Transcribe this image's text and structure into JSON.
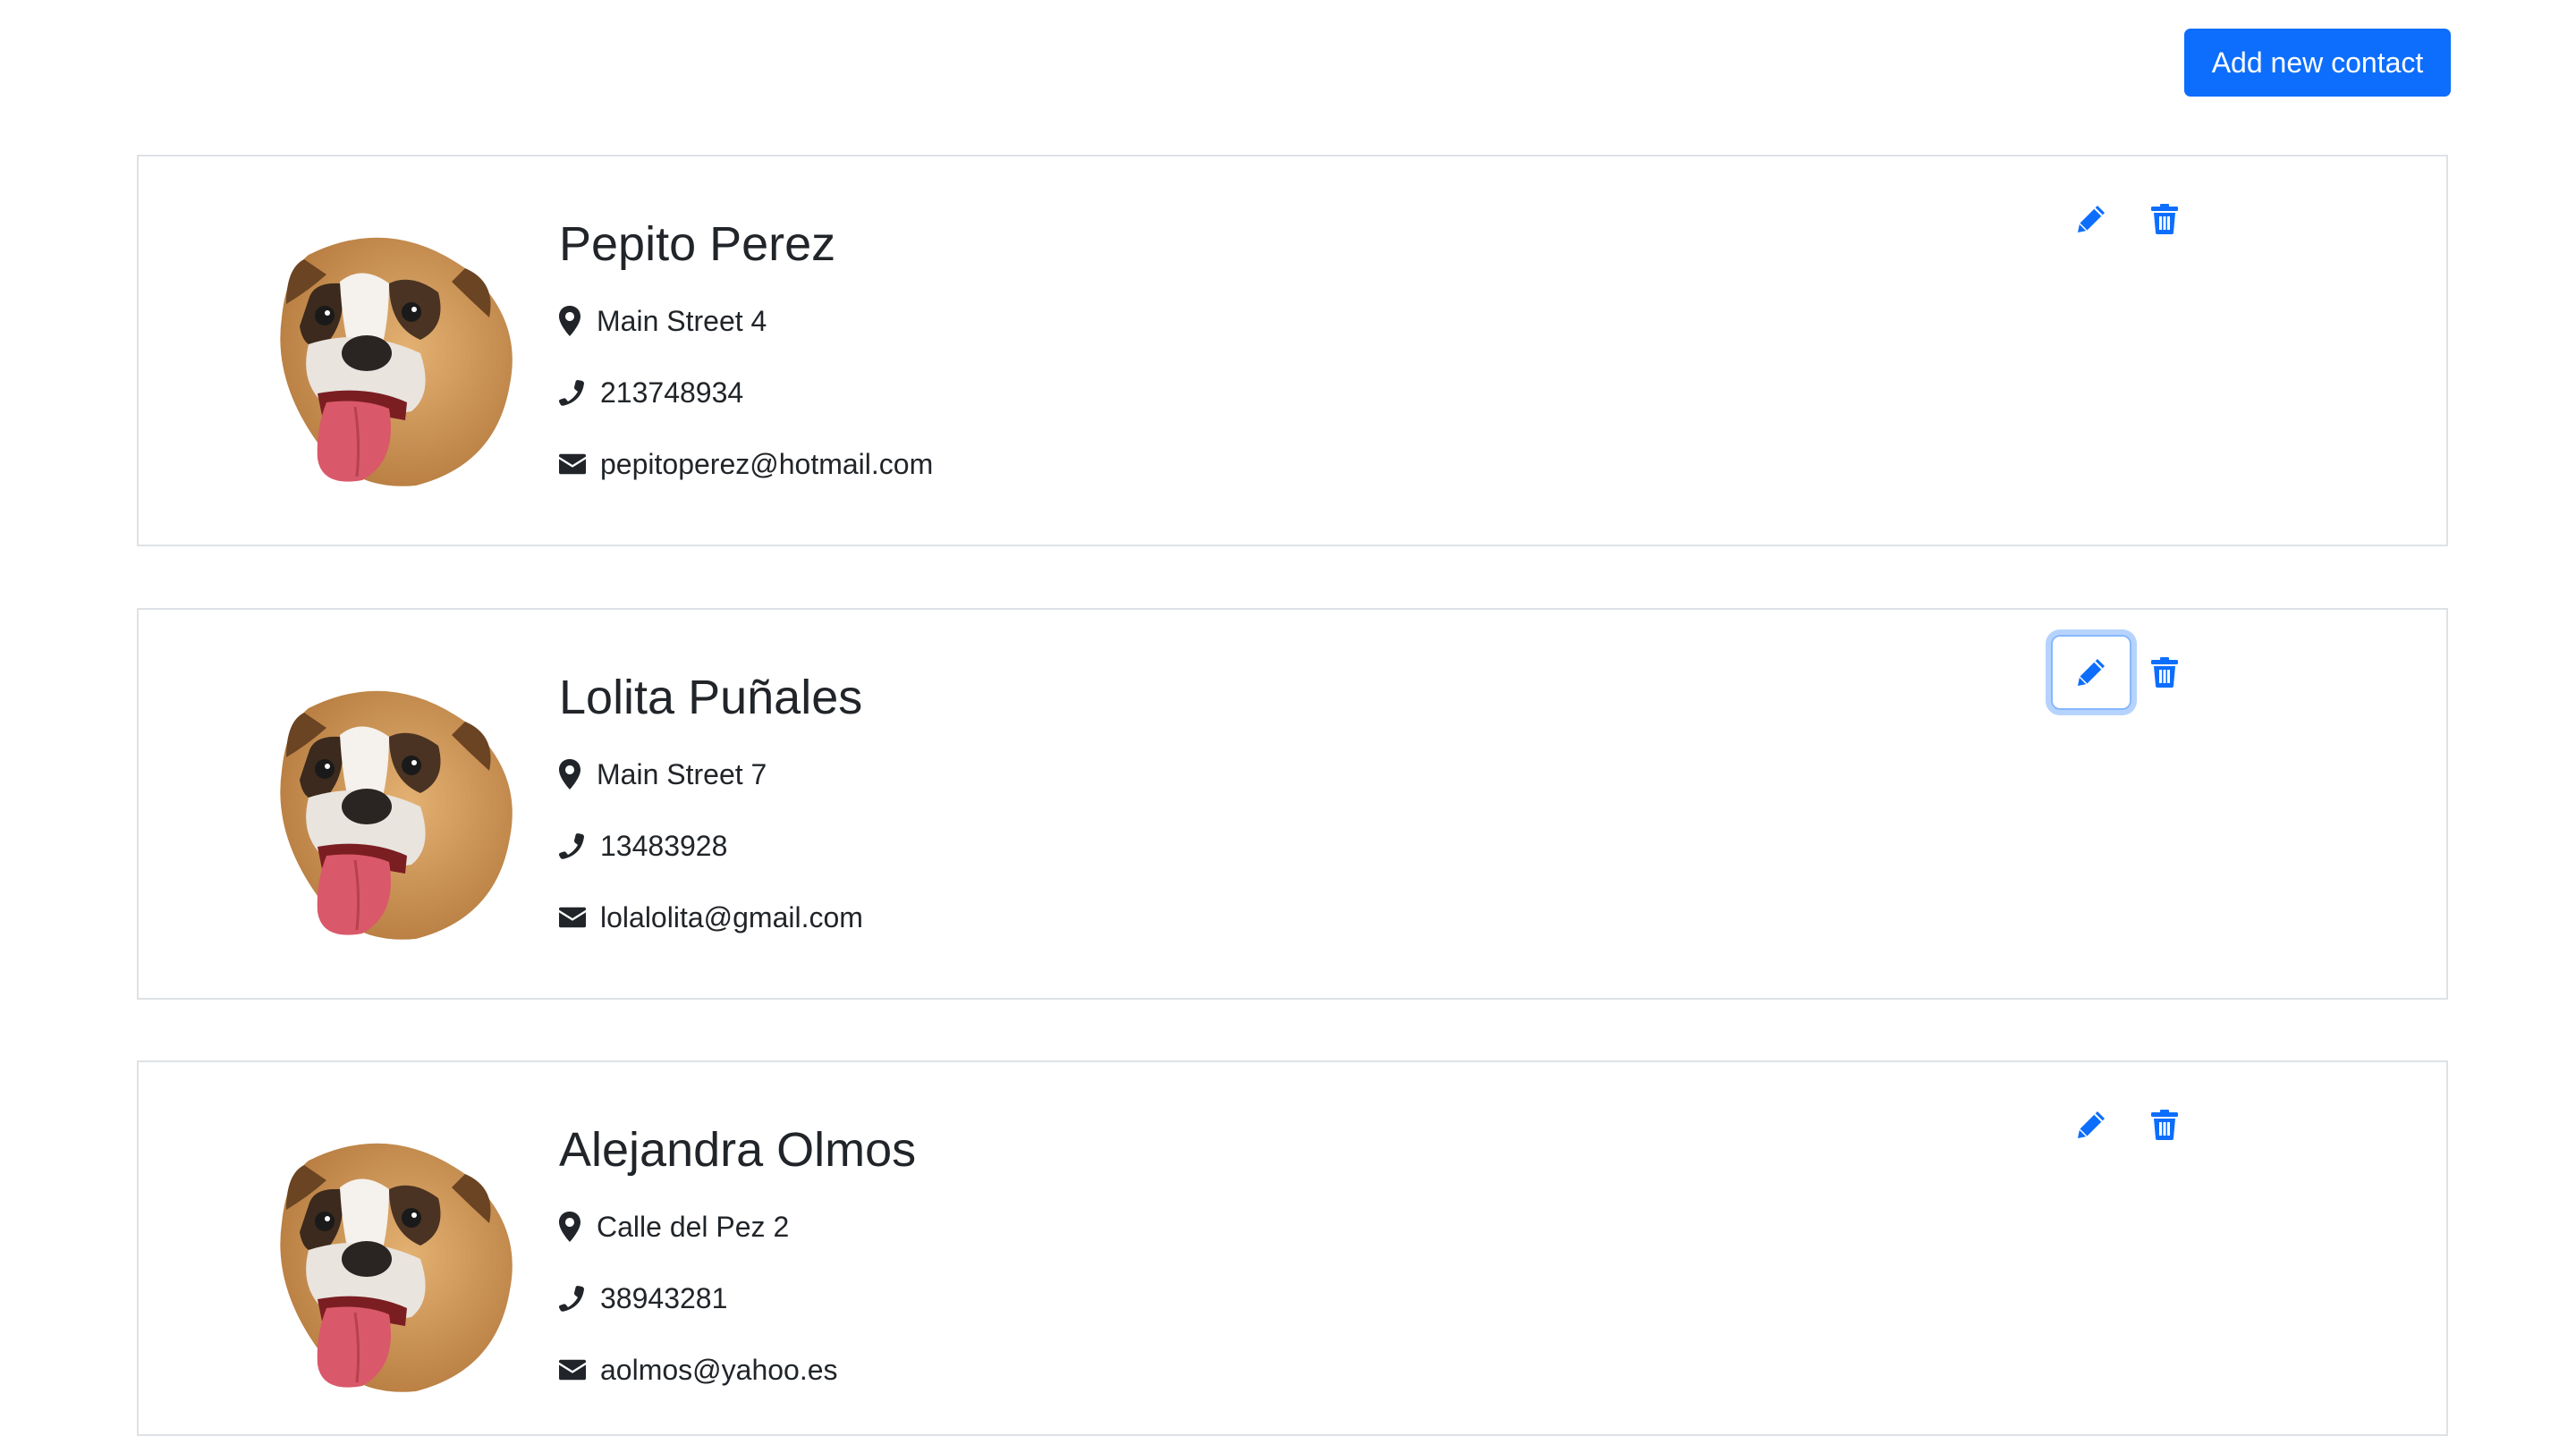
{
  "header": {
    "add_contact_label": "Add new contact"
  },
  "colors": {
    "primary": "#0d6efd",
    "text": "#212529",
    "border": "#dee2e6"
  },
  "icons": {
    "address": "map-pin-icon",
    "phone": "phone-icon",
    "email": "envelope-icon",
    "edit": "pencil-icon",
    "delete": "trash-icon",
    "avatar": "dog-avatar-image"
  },
  "contacts": [
    {
      "name": "Pepito Perez",
      "address": "Main Street 4",
      "phone": "213748934",
      "email": "pepitoperez@hotmail.com"
    },
    {
      "name": "Lolita Puñales",
      "address": "Main Street 7",
      "phone": "13483928",
      "email": "lolalolita@gmail.com"
    },
    {
      "name": "Alejandra Olmos",
      "address": "Calle del Pez 2",
      "phone": "38943281",
      "email": "aolmos@yahoo.es"
    }
  ]
}
